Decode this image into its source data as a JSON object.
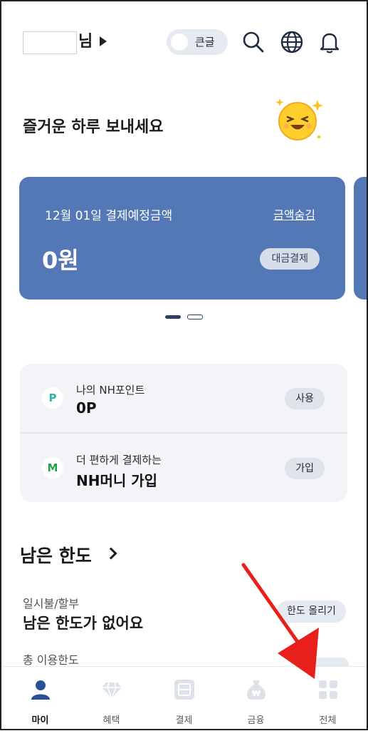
{
  "header": {
    "nim_suffix": "님",
    "font_toggle_label": "큰글",
    "icons": [
      "search-icon",
      "globe-icon",
      "bell-icon"
    ]
  },
  "greeting": "즐거운 하루 보내세요",
  "card": {
    "date_label": "12월 01일 결제예정금액",
    "hide_amount": "금액숨김",
    "amount": "0원",
    "pay_button": "대금결제",
    "color": "#5478b5"
  },
  "carousel": {
    "pages": 2,
    "active": 1
  },
  "points": {
    "nh_point": {
      "badge": "P",
      "title": "나의 NH포인트",
      "value": "0P",
      "button": "사용"
    },
    "nh_money": {
      "badge": "M",
      "title": "더 편하게 결제하는",
      "value": "NH머니 가입",
      "button": "가입"
    }
  },
  "limit": {
    "title": "남은 한도",
    "installment_label": "일시불/할부",
    "installment_message": "남은 한도가 없어요",
    "raise_button": "한도 올리기",
    "total_label": "총 이용한도"
  },
  "nav": {
    "items": [
      {
        "label": "마이",
        "icon": "person-icon",
        "active": true
      },
      {
        "label": "혜택",
        "icon": "diamond-icon",
        "active": false
      },
      {
        "label": "결제",
        "icon": "scan-icon",
        "active": false
      },
      {
        "label": "금융",
        "icon": "money-bag-icon",
        "active": false
      },
      {
        "label": "전체",
        "icon": "grid-icon",
        "active": false
      }
    ],
    "active_color": "#2a4f96"
  },
  "overlay": {
    "annotation": "red-arrow"
  }
}
